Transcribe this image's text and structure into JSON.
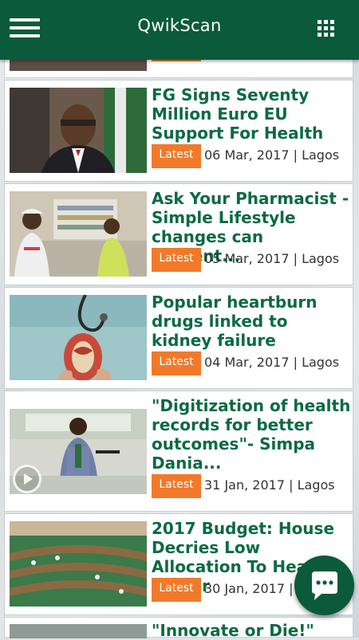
{
  "app": {
    "title": "QwikScan"
  },
  "icons": {
    "menu": "hamburger-menu-icon",
    "apps": "grid-apps-icon",
    "chat": "chat-bubble-icon",
    "play": "play-icon"
  },
  "colors": {
    "appbar": "#0b5a3c",
    "headline": "#0b6a44",
    "tag": "#f07a2a"
  },
  "articles": [
    {
      "headline": "FG Signs Seventy Million Euro EU Support For Health",
      "tag": "Latest",
      "meta": "06 Mar, 2017 | Lagos"
    },
    {
      "headline": "Ask Your Pharmacist - Simple Lifestyle changes can prevent...",
      "tag": "Latest",
      "meta": "05 Mar, 2017 | Lagos"
    },
    {
      "headline": "Popular heartburn drugs linked to kidney failure",
      "tag": "Latest",
      "meta": "04 Mar, 2017 | Lagos"
    },
    {
      "headline": "\"Digitization of health records for better outcomes\"- Simpa Dania...",
      "tag": "Latest",
      "meta": "31 Jan, 2017 | Lagos",
      "video": true
    },
    {
      "headline": "2017 Budget: House Decries Low Allocation To Health Sector",
      "tag": "Latest",
      "meta": "30 Jan, 2017 | Lagos"
    },
    {
      "headline": "\"Innovate or Die!\"",
      "tag": "",
      "meta": ""
    }
  ]
}
